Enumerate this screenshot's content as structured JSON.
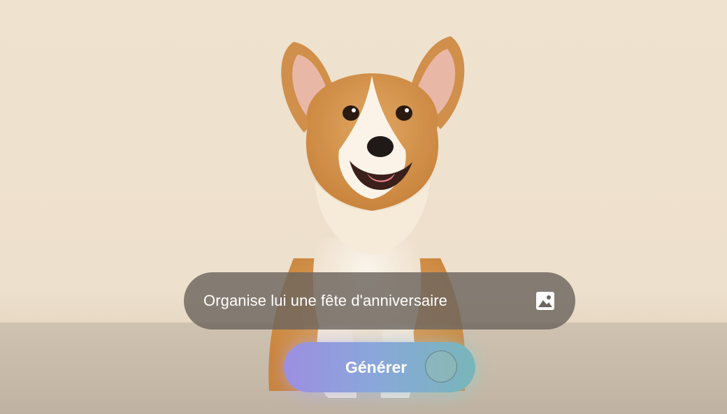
{
  "prompt": {
    "text": "Organise lui une fête d'anniversaire",
    "icon": "image-icon"
  },
  "actions": {
    "generate_label": "Générer"
  },
  "scene": {
    "subject": "corgi-dog-photo"
  },
  "colors": {
    "background": "#efe2cf",
    "prompt_bar": "#6c655e",
    "button_gradient_start": "#9c8fe0",
    "button_gradient_end": "#78b6b9"
  }
}
